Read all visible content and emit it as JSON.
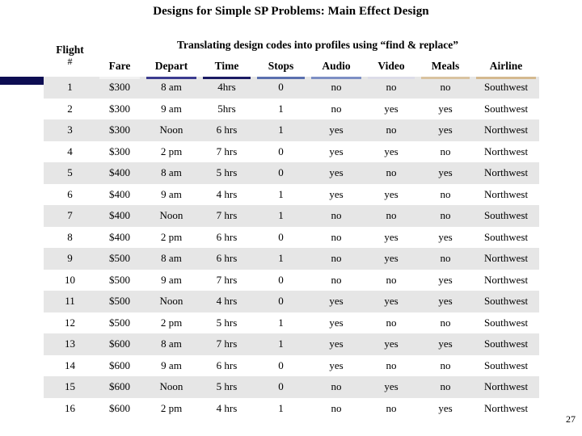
{
  "slide": {
    "title": "Designs for Simple SP Problems: Main Effect Design",
    "page_number": "27",
    "accent_color": "#0d0d52"
  },
  "table": {
    "flight_header": {
      "line1": "Flight",
      "line2": "#"
    },
    "span_header": "Translating design codes into profiles using “find &  replace”",
    "columns": [
      {
        "label": "Fare",
        "underline_color": "#f2f2f2"
      },
      {
        "label": "Depart",
        "underline_color": "#3b3b8f"
      },
      {
        "label": "Time",
        "underline_color": "#1a1a63"
      },
      {
        "label": "Stops",
        "underline_color": "#5a6fae"
      },
      {
        "label": "Audio",
        "underline_color": "#7d8fc4"
      },
      {
        "label": "Video",
        "underline_color": "#dcdce8"
      },
      {
        "label": "Meals",
        "underline_color": "#d9c3a0"
      },
      {
        "label": "Airline",
        "underline_color": "#d4b98f"
      }
    ],
    "rows": [
      {
        "flight": "1",
        "fare": "$300",
        "depart": "8 am",
        "time": "4hrs",
        "stops": "0",
        "audio": "no",
        "video": "no",
        "meals": "no",
        "airline": "Southwest"
      },
      {
        "flight": "2",
        "fare": "$300",
        "depart": "9 am",
        "time": "5hrs",
        "stops": "1",
        "audio": "no",
        "video": "yes",
        "meals": "yes",
        "airline": "Southwest"
      },
      {
        "flight": "3",
        "fare": "$300",
        "depart": "Noon",
        "time": "6 hrs",
        "stops": "1",
        "audio": "yes",
        "video": "no",
        "meals": "yes",
        "airline": "Northwest"
      },
      {
        "flight": "4",
        "fare": "$300",
        "depart": "2 pm",
        "time": "7 hrs",
        "stops": "0",
        "audio": "yes",
        "video": "yes",
        "meals": "no",
        "airline": "Northwest"
      },
      {
        "flight": "5",
        "fare": "$400",
        "depart": "8 am",
        "time": "5 hrs",
        "stops": "0",
        "audio": "yes",
        "video": "no",
        "meals": "yes",
        "airline": "Northwest"
      },
      {
        "flight": "6",
        "fare": "$400",
        "depart": "9 am",
        "time": "4 hrs",
        "stops": "1",
        "audio": "yes",
        "video": "yes",
        "meals": "no",
        "airline": "Northwest"
      },
      {
        "flight": "7",
        "fare": "$400",
        "depart": "Noon",
        "time": "7 hrs",
        "stops": "1",
        "audio": "no",
        "video": "no",
        "meals": "no",
        "airline": "Southwest"
      },
      {
        "flight": "8",
        "fare": "$400",
        "depart": "2 pm",
        "time": "6 hrs",
        "stops": "0",
        "audio": "no",
        "video": "yes",
        "meals": "yes",
        "airline": "Southwest"
      },
      {
        "flight": "9",
        "fare": "$500",
        "depart": "8 am",
        "time": "6 hrs",
        "stops": "1",
        "audio": "no",
        "video": "yes",
        "meals": "no",
        "airline": "Northwest"
      },
      {
        "flight": "10",
        "fare": "$500",
        "depart": "9 am",
        "time": "7 hrs",
        "stops": "0",
        "audio": "no",
        "video": "no",
        "meals": "yes",
        "airline": "Northwest"
      },
      {
        "flight": "11",
        "fare": "$500",
        "depart": "Noon",
        "time": "4 hrs",
        "stops": "0",
        "audio": "yes",
        "video": "yes",
        "meals": "yes",
        "airline": "Southwest"
      },
      {
        "flight": "12",
        "fare": "$500",
        "depart": "2 pm",
        "time": "5 hrs",
        "stops": "1",
        "audio": "yes",
        "video": "no",
        "meals": "no",
        "airline": "Southwest"
      },
      {
        "flight": "13",
        "fare": "$600",
        "depart": "8 am",
        "time": "7 hrs",
        "stops": "1",
        "audio": "yes",
        "video": "yes",
        "meals": "yes",
        "airline": "Southwest"
      },
      {
        "flight": "14",
        "fare": "$600",
        "depart": "9 am",
        "time": "6 hrs",
        "stops": "0",
        "audio": "yes",
        "video": "no",
        "meals": "no",
        "airline": "Southwest"
      },
      {
        "flight": "15",
        "fare": "$600",
        "depart": "Noon",
        "time": "5 hrs",
        "stops": "0",
        "audio": "no",
        "video": "yes",
        "meals": "no",
        "airline": "Northwest"
      },
      {
        "flight": "16",
        "fare": "$600",
        "depart": "2 pm",
        "time": "4 hrs",
        "stops": "1",
        "audio": "no",
        "video": "no",
        "meals": "yes",
        "airline": "Northwest"
      }
    ]
  }
}
